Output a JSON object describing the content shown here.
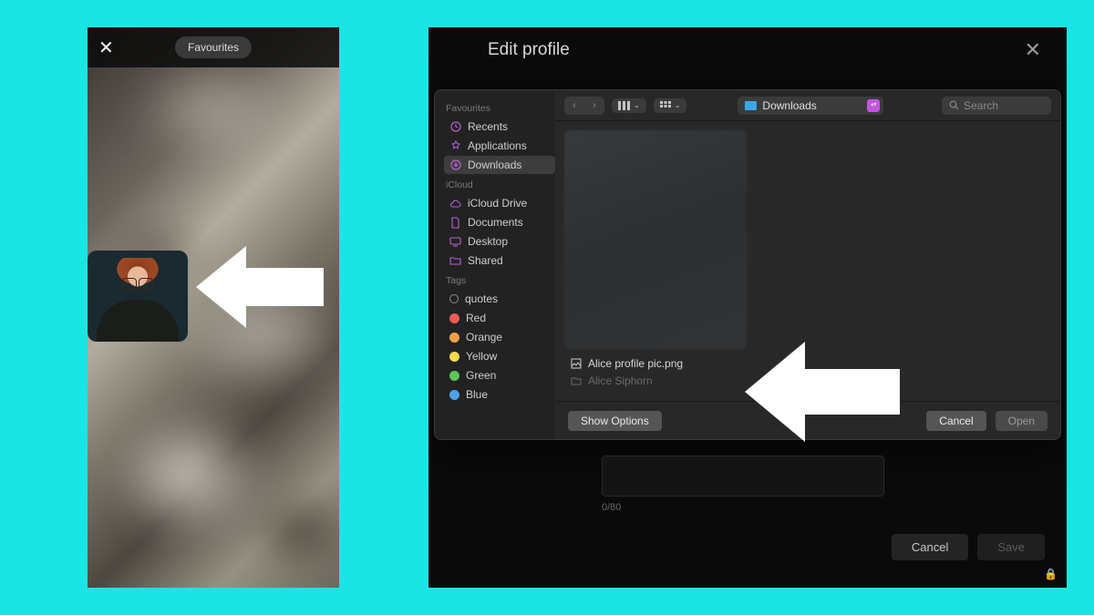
{
  "mobile": {
    "pill_label": "Favourites"
  },
  "edit_profile": {
    "title": "Edit profile",
    "char_count": "0/80",
    "cancel": "Cancel",
    "save": "Save"
  },
  "file_dialog": {
    "toolbar": {
      "path_label": "Downloads",
      "search_placeholder": "Search"
    },
    "sidebar": {
      "favourites_label": "Favourites",
      "favourites": [
        {
          "label": "Recents",
          "icon": "clock"
        },
        {
          "label": "Applications",
          "icon": "apps"
        },
        {
          "label": "Downloads",
          "icon": "download",
          "selected": true
        }
      ],
      "icloud_label": "iCloud",
      "icloud": [
        {
          "label": "iCloud Drive",
          "icon": "cloud"
        },
        {
          "label": "Documents",
          "icon": "doc"
        },
        {
          "label": "Desktop",
          "icon": "desktop"
        },
        {
          "label": "Shared",
          "icon": "folder"
        }
      ],
      "tags_label": "Tags",
      "tags": [
        {
          "label": "quotes",
          "color": "outline"
        },
        {
          "label": "Red",
          "color": "#ec5b56"
        },
        {
          "label": "Orange",
          "color": "#f0a043"
        },
        {
          "label": "Yellow",
          "color": "#f2d94b"
        },
        {
          "label": "Green",
          "color": "#5fc35a"
        },
        {
          "label": "Blue",
          "color": "#4aa3e8"
        }
      ]
    },
    "files": [
      {
        "name": "Alice profile pic.png"
      },
      {
        "name": "Alice Siphorn"
      }
    ],
    "buttons": {
      "show_options": "Show Options",
      "cancel": "Cancel",
      "open": "Open"
    }
  }
}
